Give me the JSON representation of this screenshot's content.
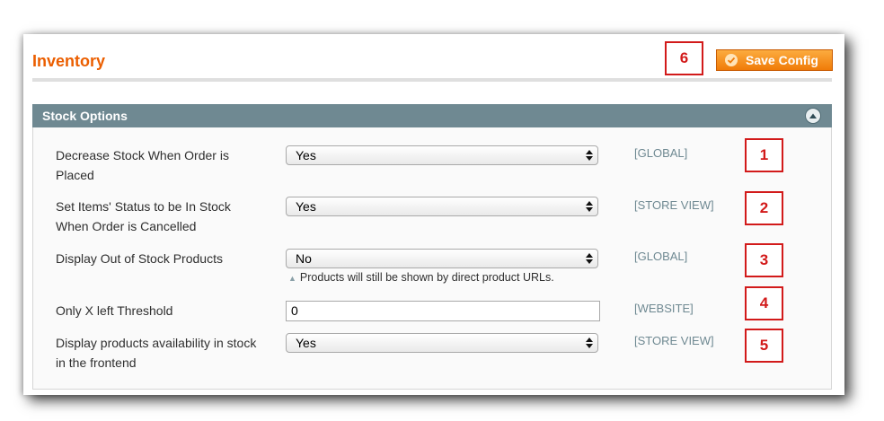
{
  "page": {
    "title": "Inventory",
    "save_label": "Save Config"
  },
  "section": {
    "title": "Stock Options"
  },
  "rows": [
    {
      "label": "Decrease Stock When Order is Placed",
      "value": "Yes",
      "scope": "[GLOBAL]",
      "marker": "1"
    },
    {
      "label": "Set Items' Status to be In Stock When Order is Cancelled",
      "value": "Yes",
      "scope": "[STORE VIEW]",
      "marker": "2"
    },
    {
      "label": "Display Out of Stock Products",
      "value": "No",
      "note": "Products will still be shown by direct product URLs.",
      "scope": "[GLOBAL]",
      "marker": "3"
    },
    {
      "label": "Only X left Threshold",
      "value": "0",
      "scope": "[WEBSITE]",
      "marker": "4"
    },
    {
      "label": "Display products availability in stock in the frontend",
      "value": "Yes",
      "scope": "[STORE VIEW]",
      "marker": "5"
    }
  ],
  "save_marker": "6",
  "colors": {
    "accent": "#eb5e00",
    "section_header": "#6f8992",
    "marker": "#d21a1a",
    "button": "#f07b08"
  },
  "icons": {
    "save": "check-circle-icon",
    "collapse": "chevron-up-icon",
    "select": "select-arrows-icon",
    "note": "triangle-up-icon"
  }
}
